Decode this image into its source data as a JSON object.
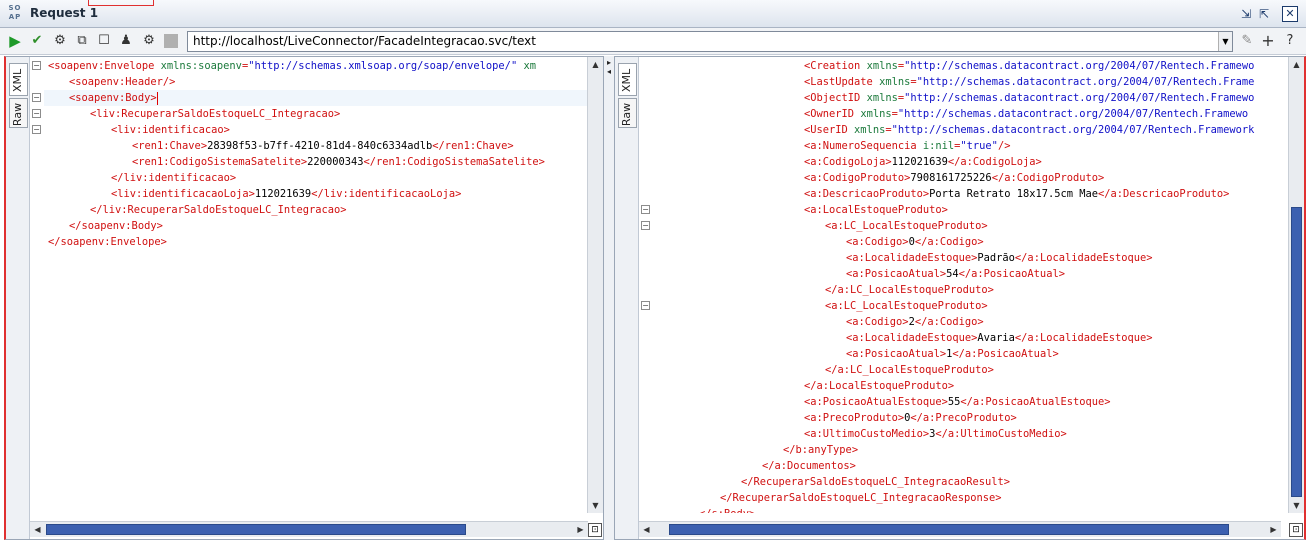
{
  "window": {
    "logo_line1": "SO",
    "logo_line2": "AP",
    "title": "Request 1"
  },
  "toolbar": {
    "endpoint_url": "http://localhost/LiveConnector/FacadeIntegracao.svc/text"
  },
  "tabs": {
    "xml": "XML",
    "raw": "Raw"
  },
  "request_lines": [
    {
      "indent": 0,
      "parts": [
        [
          "tag",
          "<soapenv:Envelope "
        ],
        [
          "attr",
          "xmlns:soapenv"
        ],
        [
          "tag",
          "="
        ],
        [
          "val",
          "\"http://schemas.xmlsoap.org/soap/envelope/\""
        ],
        [
          "attr",
          " xm"
        ]
      ]
    },
    {
      "indent": 1,
      "parts": [
        [
          "tag",
          "<soapenv:Header/>"
        ]
      ]
    },
    {
      "indent": 1,
      "parts": [
        [
          "tag",
          "<soapenv:Body>"
        ]
      ],
      "caret": true
    },
    {
      "indent": 2,
      "parts": [
        [
          "tag",
          "<liv:RecuperarSaldoEstoqueLC_Integracao>"
        ]
      ]
    },
    {
      "indent": 3,
      "parts": [
        [
          "tag",
          "<liv:identificacao>"
        ]
      ]
    },
    {
      "indent": 4,
      "parts": [
        [
          "tag",
          "<ren1:Chave>"
        ],
        [
          "txt",
          "28398f53-b7ff-4210-81d4-840c6334adlb"
        ],
        [
          "tag",
          "</ren1:Chave>"
        ]
      ]
    },
    {
      "indent": 4,
      "parts": [
        [
          "tag",
          "<ren1:CodigoSistemaSatelite>"
        ],
        [
          "txt",
          "220000343"
        ],
        [
          "tag",
          "</ren1:CodigoSistemaSatelite>"
        ]
      ]
    },
    {
      "indent": 3,
      "parts": [
        [
          "tag",
          "</liv:identificacao>"
        ]
      ]
    },
    {
      "indent": 3,
      "parts": [
        [
          "tag",
          "<liv:identificacaoLoja>"
        ],
        [
          "txt",
          "112021639"
        ],
        [
          "tag",
          "</liv:identificacaoLoja>"
        ]
      ]
    },
    {
      "indent": 2,
      "parts": [
        [
          "tag",
          "</liv:RecuperarSaldoEstoqueLC_Integracao>"
        ]
      ]
    },
    {
      "indent": 1,
      "parts": [
        [
          "tag",
          "</soapenv:Body>"
        ]
      ]
    },
    {
      "indent": 0,
      "parts": [
        [
          "tag",
          "</soapenv:Envelope>"
        ]
      ]
    }
  ],
  "response_lines": [
    {
      "indent": 7,
      "parts": [
        [
          "tag",
          "<Creation "
        ],
        [
          "attr",
          "xmlns"
        ],
        [
          "tag",
          "="
        ],
        [
          "val",
          "\"http://schemas.datacontract.org/2004/07/Rentech.Framewo"
        ]
      ]
    },
    {
      "indent": 7,
      "parts": [
        [
          "tag",
          "<LastUpdate "
        ],
        [
          "attr",
          "xmlns"
        ],
        [
          "tag",
          "="
        ],
        [
          "val",
          "\"http://schemas.datacontract.org/2004/07/Rentech.Frame"
        ]
      ]
    },
    {
      "indent": 7,
      "parts": [
        [
          "tag",
          "<ObjectID "
        ],
        [
          "attr",
          "xmlns"
        ],
        [
          "tag",
          "="
        ],
        [
          "val",
          "\"http://schemas.datacontract.org/2004/07/Rentech.Framewo"
        ]
      ]
    },
    {
      "indent": 7,
      "parts": [
        [
          "tag",
          "<OwnerID "
        ],
        [
          "attr",
          "xmlns"
        ],
        [
          "tag",
          "="
        ],
        [
          "val",
          "\"http://schemas.datacontract.org/2004/07/Rentech.Framewo"
        ]
      ]
    },
    {
      "indent": 7,
      "parts": [
        [
          "tag",
          "<UserID "
        ],
        [
          "attr",
          "xmlns"
        ],
        [
          "tag",
          "="
        ],
        [
          "val",
          "\"http://schemas.datacontract.org/2004/07/Rentech.Framework"
        ]
      ]
    },
    {
      "indent": 7,
      "parts": [
        [
          "tag",
          "<a:NumeroSequencia "
        ],
        [
          "attr",
          "i:nil"
        ],
        [
          "tag",
          "="
        ],
        [
          "val",
          "\"true\""
        ],
        [
          "tag",
          "/>"
        ]
      ]
    },
    {
      "indent": 7,
      "parts": [
        [
          "tag",
          "<a:CodigoLoja>"
        ],
        [
          "txt",
          "112021639"
        ],
        [
          "tag",
          "</a:CodigoLoja>"
        ]
      ]
    },
    {
      "indent": 7,
      "parts": [
        [
          "tag",
          "<a:CodigoProduto>"
        ],
        [
          "txt",
          "7908161725226"
        ],
        [
          "tag",
          "</a:CodigoProduto>"
        ]
      ]
    },
    {
      "indent": 7,
      "parts": [
        [
          "tag",
          "<a:DescricaoProduto>"
        ],
        [
          "txt",
          "Porta Retrato 18x17.5cm Mae"
        ],
        [
          "tag",
          "</a:DescricaoProduto>"
        ]
      ]
    },
    {
      "indent": 7,
      "parts": [
        [
          "tag",
          "<a:LocalEstoqueProduto>"
        ]
      ],
      "fold": true
    },
    {
      "indent": 8,
      "parts": [
        [
          "tag",
          "<a:LC_LocalEstoqueProduto>"
        ]
      ],
      "fold": true
    },
    {
      "indent": 9,
      "parts": [
        [
          "tag",
          "<a:Codigo>"
        ],
        [
          "txt",
          "0"
        ],
        [
          "tag",
          "</a:Codigo>"
        ]
      ]
    },
    {
      "indent": 9,
      "parts": [
        [
          "tag",
          "<a:LocalidadeEstoque>"
        ],
        [
          "txt",
          "Padrão"
        ],
        [
          "tag",
          "</a:LocalidadeEstoque>"
        ]
      ]
    },
    {
      "indent": 9,
      "parts": [
        [
          "tag",
          "<a:PosicaoAtual>"
        ],
        [
          "txt",
          "54"
        ],
        [
          "tag",
          "</a:PosicaoAtual>"
        ]
      ]
    },
    {
      "indent": 8,
      "parts": [
        [
          "tag",
          "</a:LC_LocalEstoqueProduto>"
        ]
      ]
    },
    {
      "indent": 8,
      "parts": [
        [
          "tag",
          "<a:LC_LocalEstoqueProduto>"
        ]
      ],
      "fold": true
    },
    {
      "indent": 9,
      "parts": [
        [
          "tag",
          "<a:Codigo>"
        ],
        [
          "txt",
          "2"
        ],
        [
          "tag",
          "</a:Codigo>"
        ]
      ]
    },
    {
      "indent": 9,
      "parts": [
        [
          "tag",
          "<a:LocalidadeEstoque>"
        ],
        [
          "txt",
          "Avaria"
        ],
        [
          "tag",
          "</a:LocalidadeEstoque>"
        ]
      ]
    },
    {
      "indent": 9,
      "parts": [
        [
          "tag",
          "<a:PosicaoAtual>"
        ],
        [
          "txt",
          "1"
        ],
        [
          "tag",
          "</a:PosicaoAtual>"
        ]
      ]
    },
    {
      "indent": 8,
      "parts": [
        [
          "tag",
          "</a:LC_LocalEstoqueProduto>"
        ]
      ]
    },
    {
      "indent": 7,
      "parts": [
        [
          "tag",
          "</a:LocalEstoqueProduto>"
        ]
      ]
    },
    {
      "indent": 7,
      "parts": [
        [
          "tag",
          "<a:PosicaoAtualEstoque>"
        ],
        [
          "txt",
          "55"
        ],
        [
          "tag",
          "</a:PosicaoAtualEstoque>"
        ]
      ]
    },
    {
      "indent": 7,
      "parts": [
        [
          "tag",
          "<a:PrecoProduto>"
        ],
        [
          "txt",
          "0"
        ],
        [
          "tag",
          "</a:PrecoProduto>"
        ]
      ]
    },
    {
      "indent": 7,
      "parts": [
        [
          "tag",
          "<a:UltimoCustoMedio>"
        ],
        [
          "txt",
          "3"
        ],
        [
          "tag",
          "</a:UltimoCustoMedio>"
        ]
      ]
    },
    {
      "indent": 6,
      "parts": [
        [
          "tag",
          "</b:anyType>"
        ]
      ]
    },
    {
      "indent": 5,
      "parts": [
        [
          "tag",
          "</a:Documentos>"
        ]
      ]
    },
    {
      "indent": 4,
      "parts": [
        [
          "tag",
          "</RecuperarSaldoEstoqueLC_IntegracaoResult>"
        ]
      ]
    },
    {
      "indent": 3,
      "parts": [
        [
          "tag",
          "</RecuperarSaldoEstoqueLC_IntegracaoResponse>"
        ]
      ]
    },
    {
      "indent": 2,
      "parts": [
        [
          "tag",
          "</s:Body>"
        ]
      ]
    }
  ],
  "colors": {
    "tag": "#d01010",
    "attribute": "#1c7a3c",
    "value": "#1010c8",
    "scroll_thumb": "#3c60b0",
    "panel_border": "#e03030"
  }
}
